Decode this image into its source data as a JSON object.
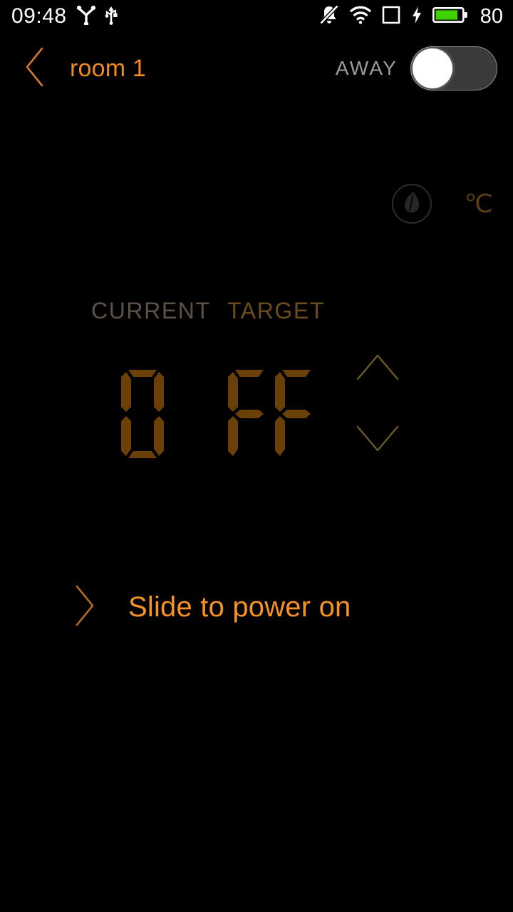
{
  "status_bar": {
    "clock": "09:48",
    "battery_percent": "80",
    "icons": [
      {
        "name": "android-beam-icon",
        "position": "left"
      },
      {
        "name": "usb-icon",
        "position": "left"
      },
      {
        "name": "silent-bell-icon",
        "position": "right"
      },
      {
        "name": "wifi-icon",
        "position": "right"
      },
      {
        "name": "sim-card-icon",
        "position": "right"
      },
      {
        "name": "charging-bolt-icon",
        "position": "right"
      },
      {
        "name": "battery-icon",
        "position": "right"
      }
    ],
    "battery_fill_color": "#3fd100",
    "text_color": "#ffffff"
  },
  "header": {
    "back_icon": "chevron-left-icon",
    "title": "room 1",
    "title_color": "#ef8b1f",
    "away_label": "AWAY",
    "away_state": "off"
  },
  "mode_row": {
    "eco_icon": "leaf-flame-icon",
    "eco_active": false,
    "unit": "℃",
    "unit_color": "#5a3b14"
  },
  "thermostat": {
    "current_label": "CURRENT",
    "target_label": "TARGET",
    "current_value": "0",
    "target_value": "FF",
    "display_reads": "OFF",
    "segment_color": "#6b4008",
    "stepper_up_icon": "chevron-up-icon",
    "stepper_down_icon": "chevron-down-icon",
    "power_state": "off"
  },
  "slider": {
    "chevron_icon": "chevron-right-icon",
    "label": "Slide to power on",
    "label_color": "#f59221"
  }
}
